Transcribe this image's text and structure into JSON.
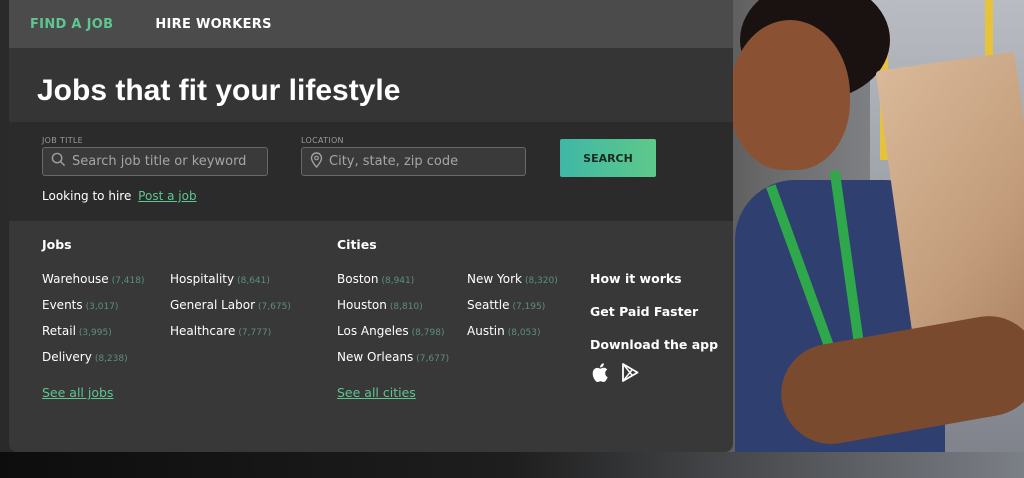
{
  "nav": {
    "find_job": "FIND A JOB",
    "hire_workers": "HIRE WORKERS"
  },
  "headline": "Jobs that fit your lifestyle",
  "search": {
    "job_title_label": "JOB TITLE",
    "job_title_placeholder": "Search job title or keyword",
    "location_label": "LOCATION",
    "location_placeholder": "City, state, zip code",
    "button": "SEARCH",
    "hire_text": "Looking to hire",
    "post_job": "Post a job"
  },
  "jobs": {
    "heading": "Jobs",
    "items": [
      {
        "label": "Warehouse",
        "count": "(7,418)"
      },
      {
        "label": "Events",
        "count": "(3,017)"
      },
      {
        "label": "Retail",
        "count": "(3,995)"
      },
      {
        "label": "Delivery",
        "count": "(8,238)"
      },
      {
        "label": "Hospitality",
        "count": "(8,641)"
      },
      {
        "label": "General Labor",
        "count": "(7,675)"
      },
      {
        "label": "Healthcare",
        "count": "(7,777)"
      }
    ],
    "see_all": "See all jobs"
  },
  "cities": {
    "heading": "Cities",
    "items": [
      {
        "label": "Boston",
        "count": "(8,941)"
      },
      {
        "label": "Houston",
        "count": "(8,810)"
      },
      {
        "label": "Los Angeles",
        "count": "(8,798)"
      },
      {
        "label": "New Orleans",
        "count": "(7,677)"
      },
      {
        "label": "New York",
        "count": "(8,320)"
      },
      {
        "label": "Seattle",
        "count": "(7,195)"
      },
      {
        "label": "Austin",
        "count": "(8,053)"
      }
    ],
    "see_all": "See all cities"
  },
  "side": {
    "how_it_works": "How it works",
    "get_paid": "Get Paid Faster",
    "download": "Download the app"
  },
  "colors": {
    "accent": "#5ec593",
    "panel": "#383838",
    "nav": "#4b4b4b"
  }
}
